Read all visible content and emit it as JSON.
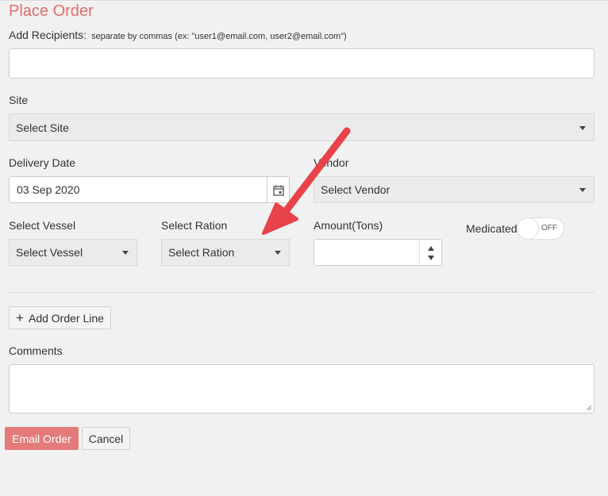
{
  "form": {
    "title": "Place Order",
    "recipients": {
      "label": "Add Recipients:",
      "hint": "separate by commas (ex: \"user1@email.com, user2@email.com\")",
      "value": ""
    },
    "site": {
      "label": "Site",
      "selected": "Select Site"
    },
    "delivery_date": {
      "label": "Delivery Date",
      "value": "03 Sep 2020"
    },
    "vendor": {
      "label": "Vendor",
      "selected": "Select Vendor"
    },
    "vessel": {
      "label": "Select Vessel",
      "selected": "Select Vessel"
    },
    "ration": {
      "label": "Select Ration",
      "selected": "Select Ration"
    },
    "amount": {
      "label": "Amount(Tons)",
      "value": ""
    },
    "medicated": {
      "label": "Medicated",
      "state": "OFF"
    },
    "add_order_line_label": "Add Order Line",
    "comments": {
      "label": "Comments",
      "value": ""
    },
    "buttons": {
      "email_order": "Email Order",
      "cancel": "Cancel"
    }
  },
  "colors": {
    "title": "#e46b6b",
    "primary_button": "#e47a7a",
    "annotation_arrow": "#e8424a"
  },
  "icons": {
    "calendar": "calendar-icon",
    "plus": "plus-icon",
    "annotation": "annotation-arrow"
  }
}
